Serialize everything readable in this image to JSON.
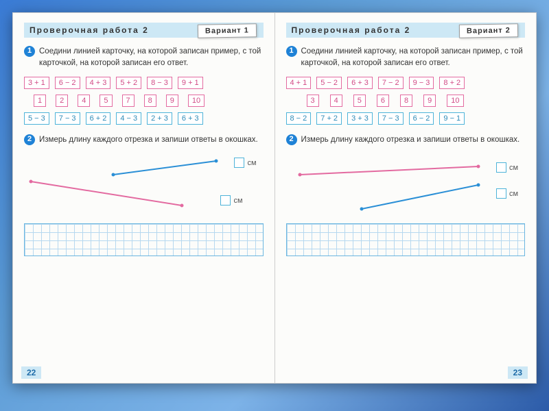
{
  "left": {
    "header": "Проверочная работа 2",
    "variant": "Вариант 1",
    "task1_num": "1",
    "task1_text": "Соедини линией карточку, на которой записан пример, с той карточкой, на которой записан его ответ.",
    "row1": [
      "3 + 1",
      "6 − 2",
      "4 + 3",
      "5 + 2",
      "8 − 3",
      "9 + 1"
    ],
    "row2": [
      "1",
      "2",
      "4",
      "5",
      "7",
      "8",
      "9",
      "10"
    ],
    "row3": [
      "5 − 3",
      "7 − 3",
      "6 + 2",
      "4 − 3",
      "2 + 3",
      "6 + 3"
    ],
    "task2_num": "2",
    "task2_text": "Измерь длину каждого отрезка и запиши ответы в окошках.",
    "cm": "см",
    "page_num": "22"
  },
  "right": {
    "header": "Проверочная работа 2",
    "variant": "Вариант 2",
    "task1_num": "1",
    "task1_text": "Соедини линией карточку, на которой записан пример, с той карточкой, на которой записан его ответ.",
    "row1": [
      "4 + 1",
      "5 − 2",
      "6 + 3",
      "7 − 2",
      "9 − 3",
      "8 + 2"
    ],
    "row2": [
      "3",
      "4",
      "5",
      "6",
      "8",
      "9",
      "10"
    ],
    "row3": [
      "8 − 2",
      "7 + 2",
      "3 + 3",
      "7 − 3",
      "6 − 2",
      "9 − 1"
    ],
    "task2_num": "2",
    "task2_text": "Измерь длину каждого отрезка и запиши ответы в окошках.",
    "cm": "см",
    "page_num": "23"
  }
}
